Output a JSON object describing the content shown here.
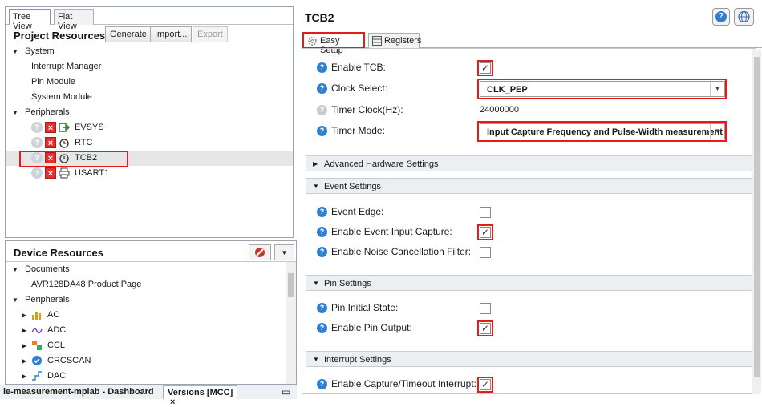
{
  "left": {
    "tabs": [
      "Tree View",
      "Flat View"
    ],
    "project_title": "Project Resources",
    "buttons": {
      "generate": "Generate",
      "import": "Import...",
      "export": "Export"
    },
    "tree": {
      "system": "System",
      "system_items": [
        "Interrupt Manager",
        "Pin Module",
        "System Module"
      ],
      "peripherals": "Peripherals",
      "peripheral_items": [
        "EVSYS",
        "RTC",
        "TCB2",
        "USART1"
      ]
    },
    "device_title": "Device Resources",
    "device_tree": {
      "documents": "Documents",
      "doc_item": "AVR128DA48 Product Page",
      "peripherals": "Peripherals",
      "items": [
        "AC",
        "ADC",
        "CCL",
        "CRCSCAN",
        "DAC"
      ]
    },
    "bottom_tabs": [
      "le-measurement-mplab - Dashboard",
      "Versions [MCC]"
    ],
    "close_glyph": "×",
    "minimize_glyph": "▭"
  },
  "right": {
    "title": "TCB2",
    "tabs": [
      "Easy Setup",
      "Registers"
    ],
    "help_glyph": "?",
    "fields": {
      "enable_tcb": "Enable TCB:",
      "clock_select": "Clock Select:",
      "clock_value": "CLK_PEP",
      "timer_clock": "Timer Clock(Hz):",
      "timer_clock_value": "24000000",
      "timer_mode": "Timer Mode:",
      "timer_mode_value": "Input Capture Frequency and Pulse-Width measurement"
    },
    "sections": {
      "advanced": "Advanced Hardware Settings",
      "event": "Event Settings",
      "pin": "Pin Settings",
      "interrupt": "Interrupt Settings"
    },
    "event_fields": [
      "Event Edge:",
      "Enable Event Input Capture:",
      "Enable Noise Cancellation Filter:"
    ],
    "pin_fields": [
      "Pin Initial State:",
      "Enable Pin Output:"
    ],
    "interrupt_fields": [
      "Enable Capture/Timeout Interrupt:"
    ],
    "check_glyph": "✓"
  },
  "colors": {
    "accent": "#2f7fd0",
    "highlight": "#e31b1b"
  }
}
